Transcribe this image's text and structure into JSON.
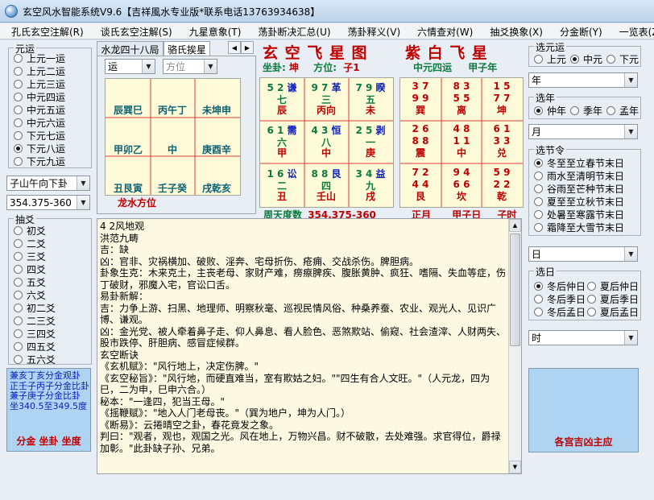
{
  "window": {
    "title": "玄空风水智能系统V9.6【吉祥風水专业版*联系电话13763934638】"
  },
  "menu": [
    "孔氏玄空注解(R)",
    "谈氏玄空注解(S)",
    "九星意象(T)",
    "荡卦断决汇总(U)",
    "荡卦释义(V)",
    "六情查对(W)",
    "抽爻换象(X)",
    "分金断(Y)",
    "一览表(Z)"
  ],
  "yuanyun": {
    "label": "元运",
    "options": [
      "上元一运",
      "上元二运",
      "上元三运",
      "中元四运",
      "中元五运",
      "中元六运",
      "下元七运",
      "下元八运",
      "下元九运"
    ],
    "selected": 7
  },
  "mountain_combo": "子山午向下卦",
  "degree_combo": "354.375-360",
  "chouyao": {
    "label": "抽爻",
    "options": [
      "初爻",
      "二爻",
      "三爻",
      "四爻",
      "五爻",
      "六爻",
      "初二爻",
      "二三爻",
      "三四爻",
      "四五爻",
      "五六爻"
    ]
  },
  "fenjin_box": {
    "lines": [
      "兼亥丁亥分金观卦",
      "正壬子丙子分金比卦",
      "兼子庚子分金比卦",
      "坐340.5至349.5度"
    ],
    "footer": "分金  坐卦  坐度"
  },
  "tabs": {
    "items": [
      "水龙四十八局",
      "骆氏挨星"
    ],
    "active": 1
  },
  "left_combos": {
    "yun": "运",
    "fangwei": "方位"
  },
  "palace_grid": {
    "cells": [
      "辰巽巳",
      "丙午丁",
      "未坤申",
      "甲卯乙",
      "中",
      "庚酉辛",
      "丑艮寅",
      "壬子癸",
      "戌乾亥"
    ],
    "caption": "龙水方位"
  },
  "flying_star": {
    "title": "玄 空 飞 星 图",
    "sit_label": "坐卦:",
    "sit_value": "坤",
    "fangwei_label": "方位:",
    "fangwei_value": "子1",
    "footer_label": "周天度数",
    "footer_value": "354.375-360",
    "cells": [
      {
        "nums": "5 2",
        "gua": "谦",
        "star": "七",
        "mtn": "辰"
      },
      {
        "nums": "9 7",
        "gua": "革",
        "star": "三",
        "mtn": "丙向"
      },
      {
        "nums": "7 9",
        "gua": "睽",
        "star": "五",
        "mtn": "未"
      },
      {
        "nums": "6 1",
        "gua": "需",
        "star": "六",
        "mtn": "甲"
      },
      {
        "nums": "4 3",
        "gua": "恒",
        "star": "八",
        "mtn": "中"
      },
      {
        "nums": "2 5",
        "gua": "剥",
        "star": "一",
        "mtn": "庚"
      },
      {
        "nums": "1 6",
        "gua": "讼",
        "star": "二",
        "mtn": "丑"
      },
      {
        "nums": "8 8",
        "gua": "艮",
        "star": "四",
        "mtn": "壬山"
      },
      {
        "nums": "3 4",
        "gua": "益",
        "star": "九",
        "mtn": "戌"
      }
    ]
  },
  "purple_white": {
    "title": "紫 白 飞 星",
    "sub1": "中元四运",
    "sub2": "甲子年",
    "cells": [
      {
        "a": "3 7",
        "b": "9 9",
        "p": "巽"
      },
      {
        "a": "8 3",
        "b": "5 5",
        "p": "离"
      },
      {
        "a": "1 5",
        "b": "7 7",
        "p": "坤"
      },
      {
        "a": "2 6",
        "b": "8 8",
        "p": "震"
      },
      {
        "a": "4 8",
        "b": "1 1",
        "p": "中"
      },
      {
        "a": "6 1",
        "b": "3 3",
        "p": "兑"
      },
      {
        "a": "7 2",
        "b": "4 4",
        "p": "艮"
      },
      {
        "a": "9 4",
        "b": "6 6",
        "p": "坎"
      },
      {
        "a": "5 9",
        "b": "2 2",
        "p": "乾"
      }
    ],
    "footer": [
      "正月",
      "甲子日",
      "子时"
    ]
  },
  "text_content": "4 2风地观\n洪范九畴\n吉：缺\n凶：官非、灾祸横加、破败、淫奔、宅母折伤、疮痈、交战杀伤。脾胆病。\n卦象生克：木来克土，主丧老母、家财产难，痨瘵脾疾、腹胀黄肿、疯狂、嗜隔、失血等症，伤丁破财，邪魔入宅，官讼口舌。\n易卦新解：\n吉：力争上游、扫黑、地理师、明察秋毫、巡视民情风俗、种桑养蚕、农业、观光人、见识广博、谦观。\n凶：金光党、被人牵着鼻子走、仰人鼻息、看人脸色、恶煞欺站、偷窥、社会渣滓、人财两失、股市跌停、肝胆病、感冒症候群。\n玄空断诀\n《玄机赋》：\"风行地上，决定伤脾。\"\n《玄空秘旨》：\"风行地，而硬直难当，室有欺姑之妇。\"\"四生有合人文旺。\"（人元龙，四为巳，二为申，巳申六合。）\n秘本：\"一逢四，犯当王母。\"\n《摇鞭赋》：\"地入人门老母丧。\"（巽为地户，坤为人门。）\n《断易》：云捲晴空之卦，春花竟发之象。\n判曰：\"观者，观也，观国之光。风在地上，万物兴昌。财不破散，去处难强。求官得位，爵禄加彰。\"此卦缺子孙、兄弟。",
  "right": {
    "xuanyuan_label": "选元运",
    "xuanyuan_options": [
      "上元",
      "中元",
      "下元"
    ],
    "xuanyuan_selected": 1,
    "year_combo": "年",
    "xuannian_label": "选年",
    "xuannian_options": [
      "仲年",
      "季年",
      "孟年"
    ],
    "xuannian_selected": 0,
    "month_combo": "月",
    "jieling_label": "选节令",
    "jieling_options": [
      "冬至至立春节末日",
      "雨水至清明节末日",
      "谷雨至芒种节末日",
      "夏至至立秋节末日",
      "处暑至寒露节末日",
      "霜降至大雪节末日"
    ],
    "jieling_selected": 0,
    "day_combo": "日",
    "xuanri_label": "选日",
    "xuanri_options": [
      "冬后仲日",
      "夏后仲日",
      "冬后季日",
      "夏后季日",
      "冬后孟日",
      "夏后孟日"
    ],
    "xuanri_selected": 0,
    "hour_combo": "时",
    "bottom_box_title": "各宫吉凶主应"
  }
}
